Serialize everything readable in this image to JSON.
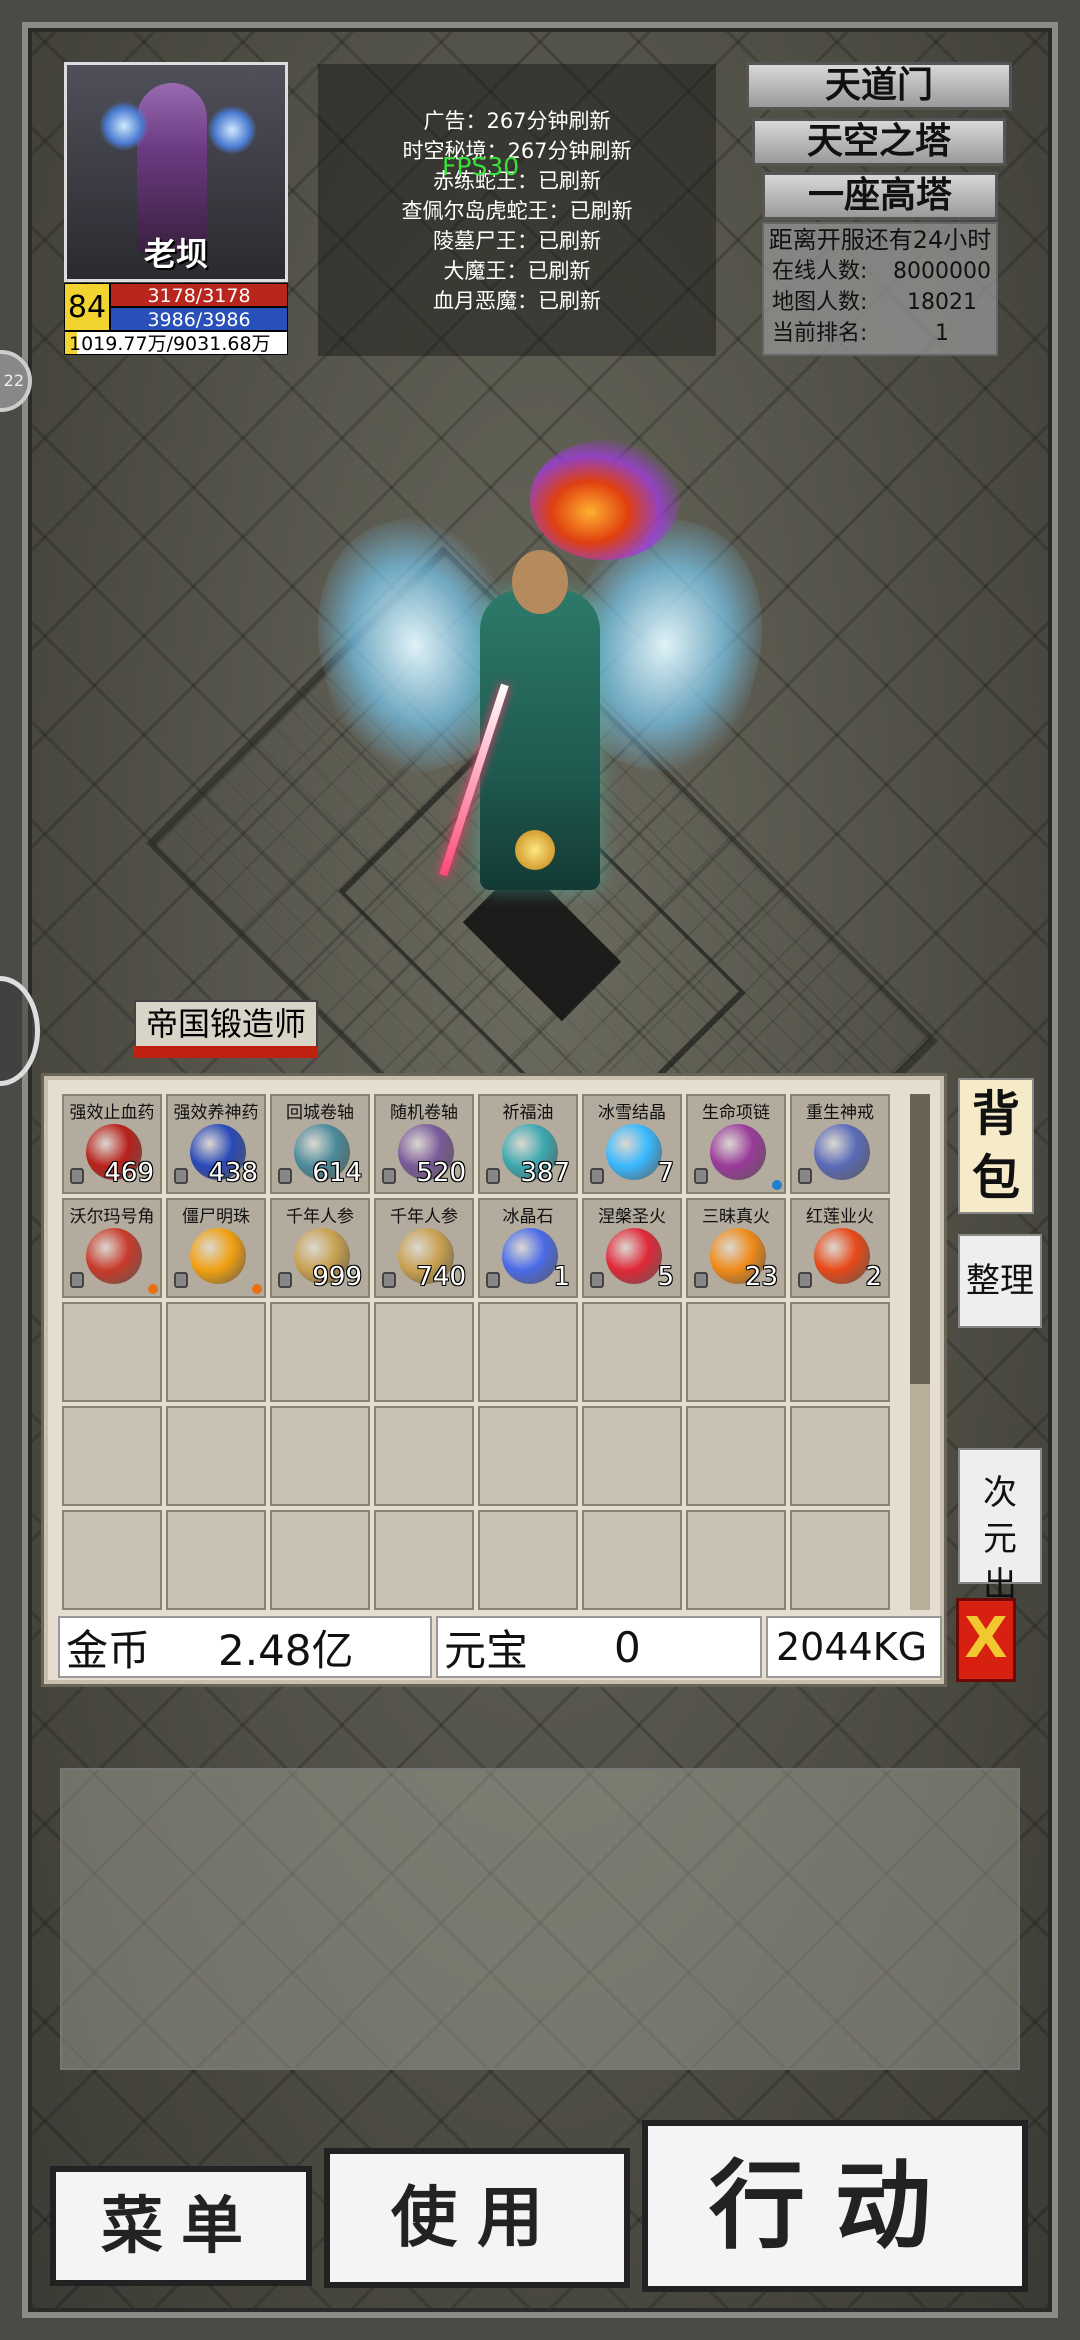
{
  "player": {
    "name": "老坝",
    "level": "84",
    "hp": "3178/3178",
    "mp": "3986/3986",
    "exp": "1019.77万/9031.68万"
  },
  "fps": "FPS30",
  "notices": [
    "广告：267分钟刷新",
    "时空秘境：267分钟刷新",
    "赤练蛇王：已刷新",
    "查佩尔岛虎蛇王：已刷新",
    "陵墓尸王：已刷新",
    "大魔王：已刷新",
    "血月恶魔：已刷新"
  ],
  "map_buttons": [
    "天道门",
    "天空之塔",
    "一座高塔"
  ],
  "server_info": {
    "title": "距离开服还有24小时",
    "online_label": "在线人数:",
    "online_value": "8000000",
    "map_label": "地图人数:",
    "map_value": "18021",
    "rank_label": "当前排名:",
    "rank_value": "1"
  },
  "npc_name": "帝国锻造师",
  "inventory": {
    "items": [
      {
        "name": "强效止血药",
        "count": "469",
        "icon": "red-potion-bag-icon",
        "color": "#b8201a"
      },
      {
        "name": "强效养神药",
        "count": "438",
        "icon": "blue-potion-bag-icon",
        "color": "#2848b8"
      },
      {
        "name": "回城卷轴",
        "count": "614",
        "icon": "scroll-icon",
        "color": "#4a8a9a"
      },
      {
        "name": "随机卷轴",
        "count": "520",
        "icon": "scroll-icon",
        "color": "#7a5a9a"
      },
      {
        "name": "祈福油",
        "count": "387",
        "icon": "oil-flask-icon",
        "color": "#3aa8b0"
      },
      {
        "name": "冰雪结晶",
        "count": "7",
        "icon": "ice-crystal-icon",
        "color": "#38b8ff"
      },
      {
        "name": "生命项链",
        "count": "",
        "icon": "necklace-icon",
        "color": "#9a3a9a"
      },
      {
        "name": "重生神戒",
        "count": "",
        "icon": "ring-icon",
        "color": "#5a6ab8"
      },
      {
        "name": "沃尔玛号角",
        "count": "",
        "icon": "horn-icon",
        "color": "#c83a2a"
      },
      {
        "name": "僵尸明珠",
        "count": "",
        "icon": "pearl-icon",
        "color": "#f0a010"
      },
      {
        "name": "千年人参",
        "count": "999",
        "icon": "ginseng-icon",
        "color": "#c8a050"
      },
      {
        "name": "千年人参",
        "count": "740",
        "icon": "ginseng-icon",
        "color": "#c8a050"
      },
      {
        "name": "冰晶石",
        "count": "1",
        "icon": "ice-stone-icon",
        "color": "#4a6ae8"
      },
      {
        "name": "涅槃圣火",
        "count": "5",
        "icon": "red-crystal-icon",
        "color": "#e02838"
      },
      {
        "name": "三昧真火",
        "count": "23",
        "icon": "fire-icon",
        "color": "#f08a18"
      },
      {
        "name": "红莲业火",
        "count": "2",
        "icon": "fire-icon",
        "color": "#e84818"
      }
    ],
    "gold_label": "金币",
    "gold_value": "2.48亿",
    "yuanbao_label": "元宝",
    "yuanbao_value": "0",
    "weight": "2044KG"
  },
  "side_buttons": {
    "bag": "背包",
    "sort": "整理",
    "sell": "次元出售",
    "close": "X"
  },
  "bottom_buttons": {
    "menu": "菜单",
    "use": "使用",
    "action": "行动"
  },
  "colors": {
    "hp_bar": "#b8261e",
    "mp_bar": "#2850b8",
    "level_badge": "#f2d430",
    "fps_text": "#38e038",
    "close_button": "#d82010"
  }
}
